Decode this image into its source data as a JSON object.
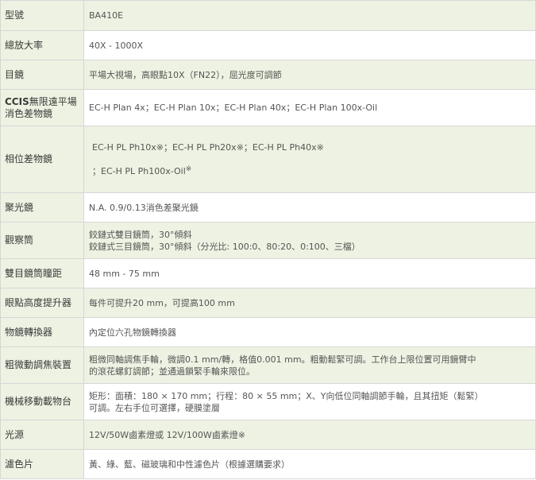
{
  "rows": [
    {
      "label": "型號",
      "value": "BA410E"
    },
    {
      "label": "總放大率",
      "value": "40X - 1000X"
    },
    {
      "label": "目鏡",
      "value": "平場大視場，高眼點10X（FN22），屈光度可調節"
    },
    {
      "label_bold": "CCIS",
      "label_rest_1": "無限遠平場",
      "label_rest_2": "消色差物鏡",
      "value": "EC-H Plan 4x；EC-H Plan 10x；EC-H Plan 40x；EC-H Plan 100x-Oil"
    },
    {
      "label": "相位差物鏡",
      "line1": "EC-H PL Ph10x※；EC-H PL Ph20x※；EC-H PL Ph40x※",
      "line2": "；EC-H PL Ph100x-Oil",
      "line2_mark": "※"
    },
    {
      "label": "聚光鏡",
      "value": "N.A. 0.9/0.13消色差聚光鏡"
    },
    {
      "label": "觀察筒",
      "line1": "鉸鏈式雙目鏡筒，30°傾斜",
      "line2": "鉸鏈式三目鏡筒，30°傾斜（分光比: 100:0、80:20、0:100、三檔）"
    },
    {
      "label": "雙目鏡筒瞳距",
      "value": "48 mm - 75 mm"
    },
    {
      "label": "眼點高度提升器",
      "value": "每件可提升20 mm，可提高100 mm"
    },
    {
      "label": "物鏡轉換器",
      "value": "內定位六孔物鏡轉換器"
    },
    {
      "label": "粗微動調焦裝置",
      "line1": "粗微同軸調焦手輪，微調0.1 mm/轉，格值0.001 mm。粗動鬆緊可調。工作台上限位置可用鏡臂中",
      "line2": "的滾花螺釘調節；並通過鎖緊手輪來限位。"
    },
    {
      "label": "機械移動載物台",
      "line1": "矩形：面積：180 × 170 mm；行程：80 × 55 mm；X、Y向低位同軸調節手輪，且其扭矩（鬆緊）",
      "line2": "可調。左右手位可選擇，硬膜塗層"
    },
    {
      "label": "光源",
      "value": "12V/50W鹵素燈或 12V/100W鹵素燈※"
    },
    {
      "label": "濾色片",
      "value": "黃、綠、藍、磁玻璃和中性濾色片（根據選購要求）"
    }
  ]
}
